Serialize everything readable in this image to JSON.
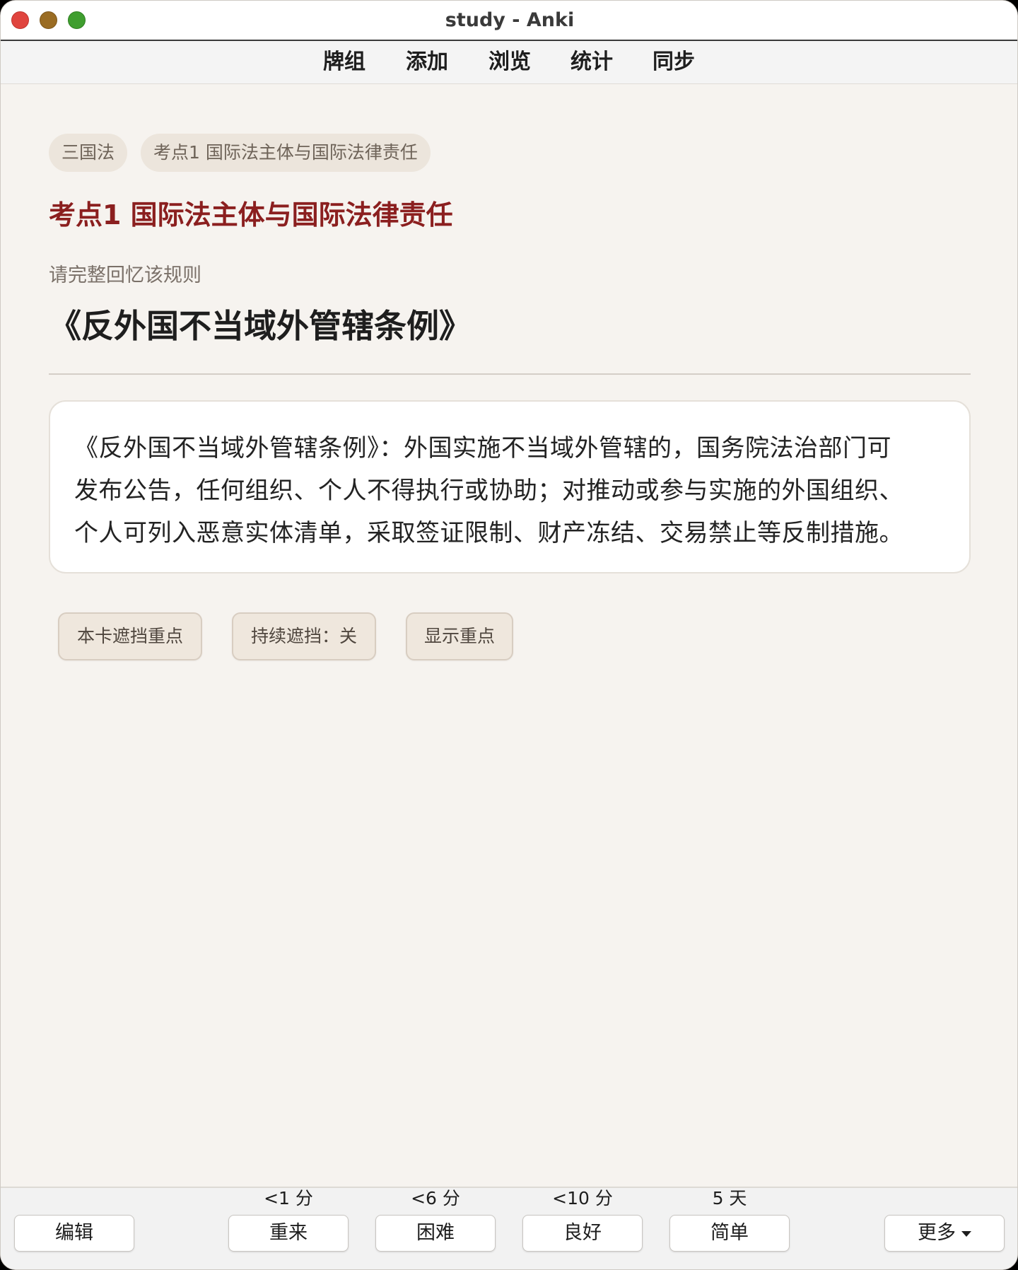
{
  "window": {
    "title": "study - Anki"
  },
  "toolbar": {
    "decks": "牌组",
    "add": "添加",
    "browse": "浏览",
    "stats": "统计",
    "sync": "同步"
  },
  "card": {
    "tags": [
      "三国法",
      "考点1 国际法主体与国际法律责任"
    ],
    "title": "考点1 国际法主体与国际法律责任",
    "prompt": "请完整回忆该规则",
    "question": "《反外国不当域外管辖条例》",
    "answer_lines": [
      "《反外国不当域外管辖条例》：外国实施不当域外管辖的，国务院法治部门可",
      "发布公告，任何组织、个人不得执行或协助；对推动或参与实施的外国组织、",
      "个人可列入恶意实体清单，采取签证限制、财产冻结、交易禁止等反制措施。"
    ],
    "buttons": {
      "mask_key": "本卡遮挡重点",
      "persistent_mask": "持续遮挡：关",
      "show_key": "显示重点"
    }
  },
  "bottom": {
    "edit": "编辑",
    "more": "更多",
    "answers": [
      {
        "interval": "<1 分",
        "label": "重来"
      },
      {
        "interval": "<6 分",
        "label": "困难"
      },
      {
        "interval": "<10 分",
        "label": "良好"
      },
      {
        "interval": "5 天",
        "label": "简单"
      }
    ]
  }
}
